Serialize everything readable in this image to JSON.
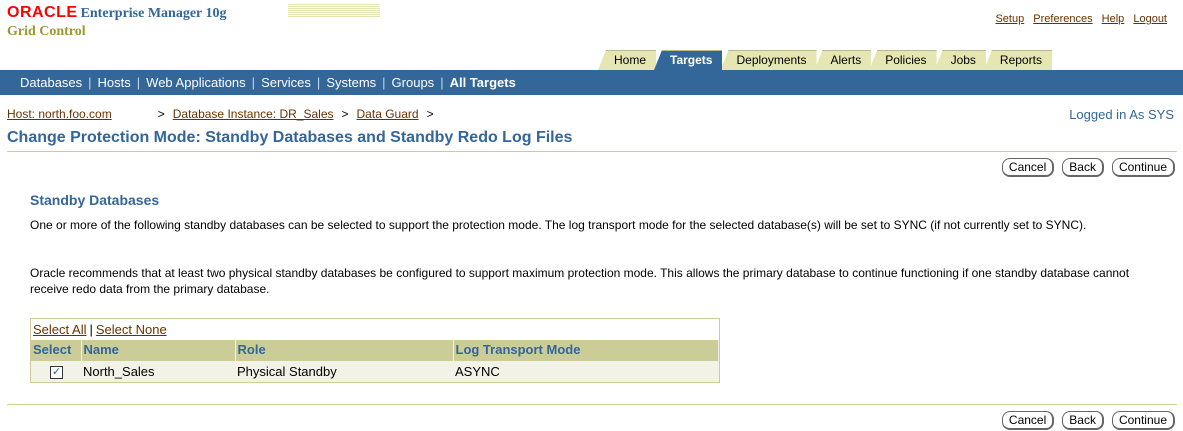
{
  "branding": {
    "oracle": "ORACLE",
    "product": "Enterprise Manager 10g",
    "subproduct": "Grid Control"
  },
  "global_links": [
    "Setup",
    "Preferences",
    "Help",
    "Logout"
  ],
  "tabs": [
    {
      "label": "Home"
    },
    {
      "label": "Targets",
      "active": true
    },
    {
      "label": "Deployments"
    },
    {
      "label": "Alerts"
    },
    {
      "label": "Policies"
    },
    {
      "label": "Jobs"
    },
    {
      "label": "Reports"
    }
  ],
  "subtabs": [
    {
      "label": "Databases"
    },
    {
      "label": "Hosts"
    },
    {
      "label": "Web Applications"
    },
    {
      "label": "Services"
    },
    {
      "label": "Systems"
    },
    {
      "label": "Groups"
    },
    {
      "label": "All Targets",
      "current": true
    }
  ],
  "breadcrumb": {
    "host": "Host: north.foo.com",
    "instance": "Database Instance: DR_Sales",
    "dataguard": "Data Guard",
    "sep": ">"
  },
  "logged_in": "Logged in As SYS",
  "page_title": "Change Protection Mode: Standby Databases and Standby Redo Log Files",
  "buttons": {
    "cancel": "Cancel",
    "back": "Back",
    "continue": "Continue"
  },
  "section": {
    "heading": "Standby Databases",
    "para1": "One or more of the following standby databases can be selected to support the protection mode. The log transport mode for the selected database(s) will be set to SYNC (if not currently set to SYNC).",
    "para2": "Oracle recommends that at least two physical standby databases be configured to support maximum protection mode. This allows the primary database to continue functioning if one standby database cannot receive redo data from the primary database."
  },
  "table": {
    "select_all": "Select All",
    "select_none": "Select None",
    "columns": [
      "Select",
      "Name",
      "Role",
      "Log Transport Mode"
    ],
    "rows": [
      {
        "checked": true,
        "name": "North_Sales",
        "role": "Physical Standby",
        "mode": "ASYNC"
      }
    ]
  },
  "colors": {
    "brand_blue": "#336699",
    "tan": "#cccc99",
    "oracle_red": "#ff0000"
  }
}
